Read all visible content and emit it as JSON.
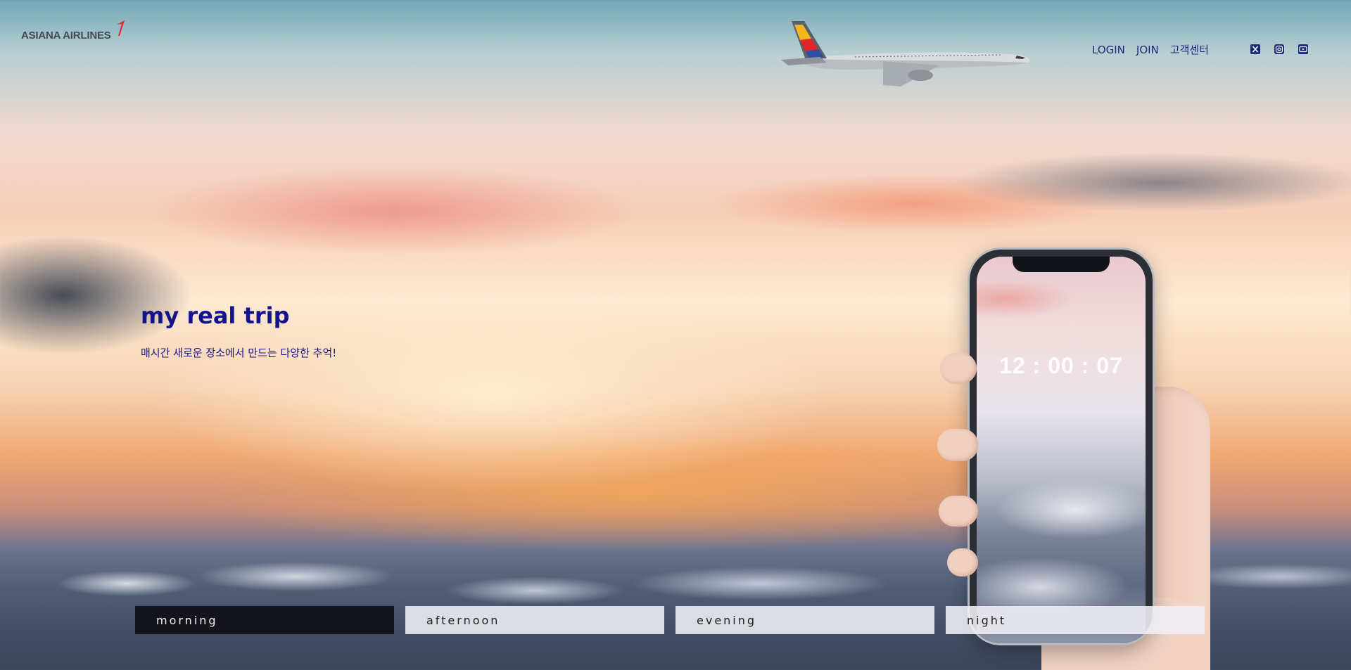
{
  "header": {
    "logo_text": "ASIANA AIRLINES",
    "nav": [
      {
        "label": "LOGIN"
      },
      {
        "label": "JOIN"
      },
      {
        "label": "고객센터"
      }
    ],
    "social_icons": [
      "x-icon",
      "instagram-icon",
      "youtube-icon"
    ]
  },
  "hero": {
    "title": "my real trip",
    "subtitle": "매시간 새로운 장소에서 만드는 다양한 추억!"
  },
  "phone": {
    "clock": "12 : 00 : 07"
  },
  "tabs": [
    {
      "label": "morning",
      "active": true
    },
    {
      "label": "afternoon",
      "active": false
    },
    {
      "label": "evening",
      "active": false
    },
    {
      "label": "night",
      "active": false
    }
  ],
  "colors": {
    "brand_red": "#e4262a",
    "nav_text": "#1d2a7a",
    "hero_title": "#13148c",
    "active_tab_bg": "#14151c",
    "tab_bg": "#f0f0f6"
  }
}
